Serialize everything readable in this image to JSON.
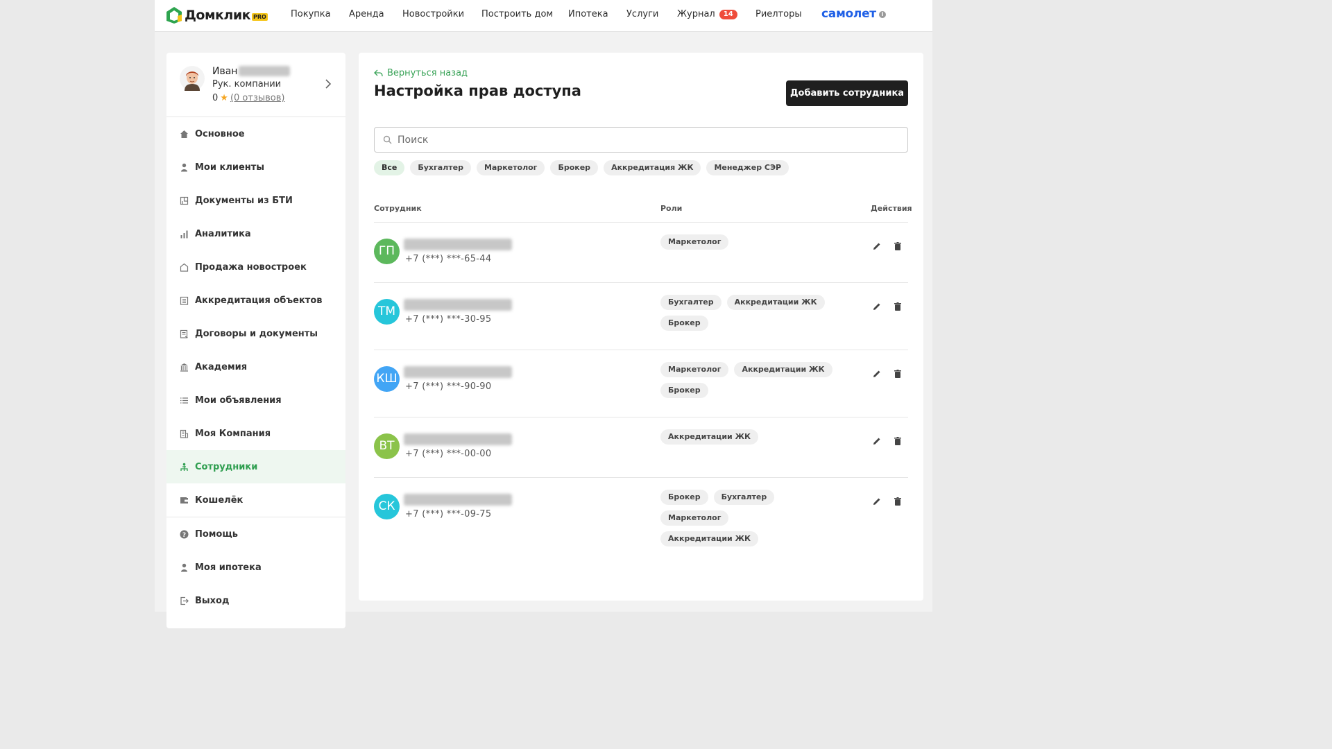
{
  "header": {
    "logo_text": "Домклик",
    "logo_badge": "PRO",
    "nav": [
      "Покупка",
      "Аренда",
      "Новостройки",
      "Построить дом",
      "Ипотека",
      "Услуги",
      "Журнал",
      "Риелторы"
    ],
    "journal_badge": "14",
    "partner": "самолет",
    "partner_info": "i"
  },
  "profile": {
    "first_name": "Иван",
    "role": "Рук. компании",
    "rating": "0",
    "reviews": "(0 отзывов)"
  },
  "sidebar": {
    "items": [
      {
        "label": "Основное",
        "icon": "home-icon"
      },
      {
        "label": "Мои клиенты",
        "icon": "person-icon"
      },
      {
        "label": "Документы из БТИ",
        "icon": "floorplan-icon"
      },
      {
        "label": "Аналитика",
        "icon": "bar-chart-icon"
      },
      {
        "label": "Продажа новостроек",
        "icon": "house-outline-icon"
      },
      {
        "label": "Аккредитация объектов",
        "icon": "building-list-icon"
      },
      {
        "label": "Договоры и документы",
        "icon": "contract-icon"
      },
      {
        "label": "Академия",
        "icon": "academy-icon"
      },
      {
        "label": "Мои объявления",
        "icon": "list-icon"
      },
      {
        "label": "Моя Компания",
        "icon": "company-icon"
      },
      {
        "label": "Сотрудники",
        "icon": "employees-icon"
      },
      {
        "label": "Кошелёк",
        "icon": "wallet-icon"
      }
    ],
    "bottom_items": [
      {
        "label": "Помощь",
        "icon": "help-icon"
      },
      {
        "label": "Моя ипотека",
        "icon": "person-icon"
      },
      {
        "label": "Выход",
        "icon": "logout-icon"
      }
    ],
    "active_index": 10
  },
  "main": {
    "back_label": "Вернуться назад",
    "title": "Настройка прав доступа",
    "add_button": "Добавить сотрудника",
    "search_placeholder": "Поиск",
    "filters": [
      "Все",
      "Бухгалтер",
      "Маркетолог",
      "Брокер",
      "Аккредитация ЖК",
      "Менеджер СЭР"
    ],
    "active_filter": 0,
    "columns": {
      "employee": "Сотрудник",
      "roles": "Роли",
      "actions": "Действия"
    },
    "employees": [
      {
        "initials": "ГП",
        "color": "#5cb85c",
        "phone": "+7 (***) ***-65-44",
        "roles": [
          "Маркетолог"
        ]
      },
      {
        "initials": "ТМ",
        "color": "#26c6da",
        "phone": "+7 (***) ***-30-95",
        "roles": [
          "Бухгалтер",
          "Аккредитации ЖК",
          "Брокер"
        ]
      },
      {
        "initials": "КШ",
        "color": "#42a5f5",
        "phone": "+7 (***) ***-90-90",
        "roles": [
          "Маркетолог",
          "Аккредитации ЖК",
          "Брокер"
        ]
      },
      {
        "initials": "ВТ",
        "color": "#8bc34a",
        "phone": "+7 (***) ***-00-00",
        "roles": [
          "Аккредитации ЖК"
        ]
      },
      {
        "initials": "СК",
        "color": "#26c6da",
        "phone": "+7 (***) ***-09-75",
        "roles": [
          "Брокер",
          "Бухгалтер",
          "Маркетолог",
          "Аккредитации ЖК"
        ]
      }
    ]
  },
  "colors": {
    "accent": "#2e9e4f",
    "primary_button": "#1f1f1f",
    "badge": "#ef4c3b",
    "partner": "#1e5fe6"
  }
}
